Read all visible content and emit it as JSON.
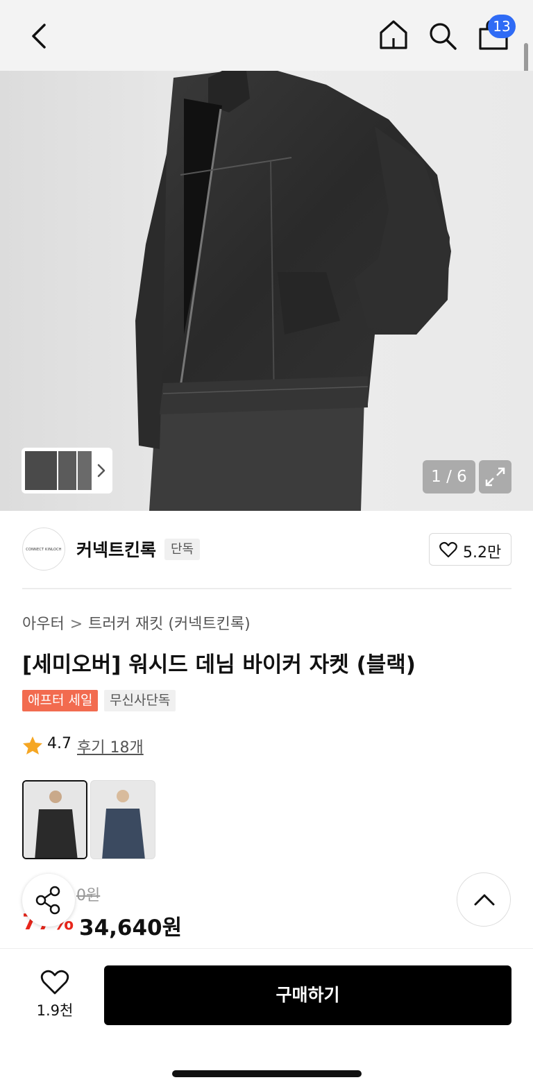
{
  "header": {
    "cart_count": "13",
    "icons": [
      "back-arrow-icon",
      "home-icon",
      "search-icon",
      "shopping-bag-icon"
    ]
  },
  "gallery": {
    "counter": "1 / 6"
  },
  "brand": {
    "logo_text": "CONNECT KINLOCH",
    "name": "커넥트킨록",
    "tag": "단독",
    "like_count": "5.2만"
  },
  "breadcrumb": {
    "category": "아우터",
    "subcategory": "트러커 재킷 (커넥트킨록)"
  },
  "product": {
    "title": "[세미오버] 워시드 데님 바이커 자켓 (블랙)",
    "badges": [
      "애프터 세일",
      "무신사단독"
    ],
    "rating": "4.7",
    "reviews": "후기 18개",
    "original_price": "0원",
    "discount": "77%",
    "price": "34,640원"
  },
  "bottom_bar": {
    "wish_count": "1.9천",
    "buy_label": "구매하기"
  },
  "colors": {
    "badge_blue": "#2f6bf5",
    "sale_orange": "#f26b4f",
    "discount_red": "#e8261b"
  }
}
